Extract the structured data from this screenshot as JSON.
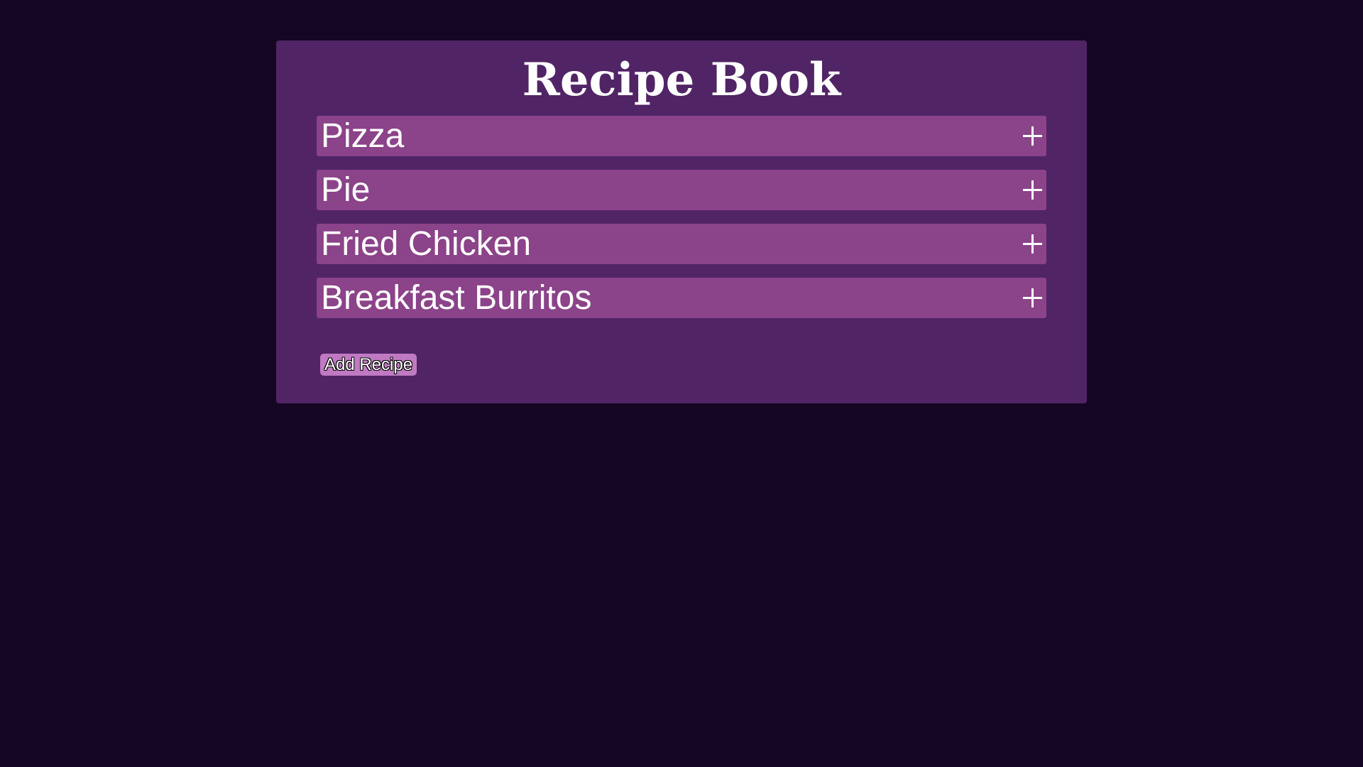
{
  "page": {
    "title": "Recipe Book"
  },
  "recipes": [
    {
      "name": "Pizza",
      "icon": "plus-icon"
    },
    {
      "name": "Pie",
      "icon": "plus-icon"
    },
    {
      "name": "Fried Chicken",
      "icon": "plus-icon"
    },
    {
      "name": "Breakfast Burritos",
      "icon": "plus-icon"
    }
  ],
  "actions": {
    "add_label": "Add Recipe"
  },
  "colors": {
    "background": "#150623",
    "panel": "#512466",
    "recipe_item": "#8b4389",
    "add_button": "#c07ac2",
    "text": "#ffffff"
  }
}
